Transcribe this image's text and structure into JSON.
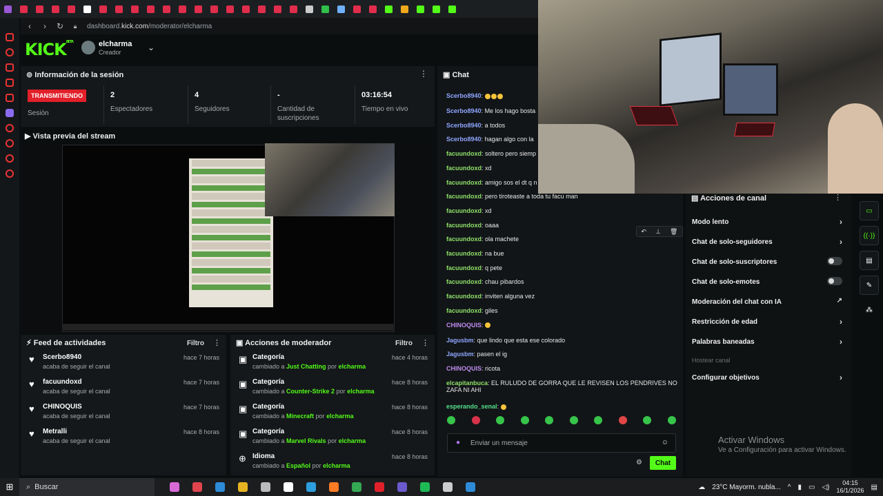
{
  "browser": {
    "url_prefix": "dashboard.",
    "url_host": "kick.com",
    "url_path": "/moderator/elcharma",
    "tabs": [
      "#9a58d6",
      "#e02d4c",
      "#e02d4c",
      "#e02d4c",
      "#e02d4c",
      "#ffffff",
      "#e02d4c",
      "#e02d4c",
      "#e02d4c",
      "#e02d4c",
      "#e02d4c",
      "#e02d4c",
      "#e02d4c",
      "#e02d4c",
      "#e02d4c",
      "#e02d4c",
      "#e02d4c",
      "#e02d4c",
      "#e02d4c",
      "#cccccc",
      "#2fbf4a",
      "#6fb1ff",
      "#e02d4c",
      "#e02d4c",
      "#53fc18",
      "#f0a81c",
      "#53fc18",
      "#53fc18",
      "#53fc18"
    ]
  },
  "header": {
    "logo": "KICK",
    "logo_beta": "BETA",
    "username": "elcharma",
    "role": "Creador"
  },
  "session": {
    "title": "Información de la sesión",
    "badge": "TRANSMITIENDO",
    "badge_label": "Sesión",
    "stats": [
      {
        "value": "2",
        "label": "Espectadores"
      },
      {
        "value": "4",
        "label": "Seguidores"
      },
      {
        "value": "-",
        "label": "Cantidad de suscripciones"
      },
      {
        "value": "03:16:54",
        "label": "Tiempo en vivo"
      }
    ]
  },
  "preview": {
    "title": "Vista previa del stream"
  },
  "feed": {
    "title": "Feed de actividades",
    "filter": "Filtro",
    "items": [
      {
        "name": "Scerbo8940",
        "sub": "acaba de seguir el canal",
        "time": "hace 7 horas"
      },
      {
        "name": "facuundoxd",
        "sub": "acaba de seguir el canal",
        "time": "hace 7 horas"
      },
      {
        "name": "CHINOQUIS",
        "sub": "acaba de seguir el canal",
        "time": "hace 7 horas"
      },
      {
        "name": "Metralli",
        "sub": "acaba de seguir el canal",
        "time": "hace 8 horas"
      }
    ]
  },
  "mod_actions": {
    "title": "Acciones de moderador",
    "filter": "Filtro",
    "items": [
      {
        "name": "Categoría",
        "pre": "cambiado a ",
        "what": "Just Chatting",
        "by": " por ",
        "who": "elcharma",
        "time": "hace 4 horas"
      },
      {
        "name": "Categoría",
        "pre": "cambiado a ",
        "what": "Counter-Strike 2",
        "by": " por ",
        "who": "elcharma",
        "time": "hace 8 horas"
      },
      {
        "name": "Categoría",
        "pre": "cambiado a ",
        "what": "Minecraft",
        "by": " por ",
        "who": "elcharma",
        "time": "hace 8 horas"
      },
      {
        "name": "Categoría",
        "pre": "cambiado a ",
        "what": "Marvel Rivals",
        "by": " por ",
        "who": "elcharma",
        "time": "hace 8 horas"
      },
      {
        "name": "Idioma",
        "pre": "cambiado a ",
        "what": "Español",
        "by": " por ",
        "who": "elcharma",
        "time": "hace 8 horas"
      }
    ]
  },
  "chat": {
    "title": "Chat",
    "messages": [
      {
        "user": "Scerbo8940",
        "color": "#8ea6ff",
        "text": "",
        "emotes": 3
      },
      {
        "user": "Scerbo8940",
        "color": "#8ea6ff",
        "text": "Me los hago bosta",
        "emotes": 0
      },
      {
        "user": "Scerbo8940",
        "color": "#8ea6ff",
        "text": "a todos",
        "emotes": 0
      },
      {
        "user": "Scerbo8940",
        "color": "#8ea6ff",
        "text": "hagan algo con la",
        "emotes": 0
      },
      {
        "user": "facuundoxd",
        "color": "#8ee06a",
        "text": "soltero pero siemp",
        "emotes": 0
      },
      {
        "user": "facuundoxd",
        "color": "#8ee06a",
        "text": "xd",
        "emotes": 0
      },
      {
        "user": "facuundoxd",
        "color": "#8ee06a",
        "text": "amigo sos el dt q n",
        "emotes": 0
      },
      {
        "user": "facuundoxd",
        "color": "#8ee06a",
        "text": "pero tiroteaste a toda tu facu man",
        "emotes": 0
      },
      {
        "user": "facuundoxd",
        "color": "#8ee06a",
        "text": "xd",
        "emotes": 0
      },
      {
        "user": "facuundoxd",
        "color": "#8ee06a",
        "text": "oaaa",
        "emotes": 0
      },
      {
        "user": "facuundoxd",
        "color": "#8ee06a",
        "text": "ola machete",
        "emotes": 0
      },
      {
        "user": "facuundoxd",
        "color": "#8ee06a",
        "text": "na bue",
        "emotes": 0
      },
      {
        "user": "facuundoxd",
        "color": "#8ee06a",
        "text": "q pete",
        "emotes": 0
      },
      {
        "user": "facuundoxd",
        "color": "#8ee06a",
        "text": "chau pibardos",
        "emotes": 0
      },
      {
        "user": "facuundoxd",
        "color": "#8ee06a",
        "text": "inviten alguna vez",
        "emotes": 0
      },
      {
        "user": "facuundoxd",
        "color": "#8ee06a",
        "text": "giles",
        "emotes": 0
      },
      {
        "user": "CHINOQUIS",
        "color": "#c08cf0",
        "text": "",
        "emotes": 1
      },
      {
        "user": "Jagusbm",
        "color": "#8ea6ff",
        "text": "que lindo que esta ese colorado",
        "emotes": 0
      },
      {
        "user": "Jagusbm",
        "color": "#8ea6ff",
        "text": "pasen el ig",
        "emotes": 0
      },
      {
        "user": "CHINOQUIS",
        "color": "#c08cf0",
        "text": "ricota",
        "emotes": 0
      },
      {
        "user": "elcapitanbuca",
        "color": "#8ee06a",
        "text": "EL RULUDO DE GORRA QUE LE REVISEN LOS PENDRIVES NO",
        "text2": "ZAFA NI AHI",
        "emotes": 0
      },
      {
        "user": "esperando_senal",
        "color": "#53e08a",
        "text": "",
        "emotes": 1
      }
    ],
    "input_placeholder": "Enviar un mensaje",
    "send_label": "Chat"
  },
  "channel_actions": {
    "title": "Acciones de canal",
    "items": [
      {
        "label": "Modo lento",
        "control": "chevron"
      },
      {
        "label": "Chat de solo-seguidores",
        "control": "chevron"
      },
      {
        "label": "Chat de solo-suscriptores",
        "control": "toggle"
      },
      {
        "label": "Chat de solo-emotes",
        "control": "toggle"
      },
      {
        "label": "Moderación del chat con IA",
        "control": "external"
      },
      {
        "label": "Restricción de edad",
        "control": "chevron"
      },
      {
        "label": "Palabras baneadas",
        "control": "chevron"
      },
      {
        "label": "Hostear canal",
        "control": "none",
        "disabled": true
      },
      {
        "label": "Configurar objetivos",
        "control": "chevron"
      }
    ],
    "watermark_title": "Activar Windows",
    "watermark_sub": "Ve a Configuración para activar Windows."
  },
  "taskbar": {
    "search": "Buscar",
    "weather": "23°C  Mayorm. nubla...",
    "time": "04:15",
    "date": "16/1/2026",
    "apps": [
      "#d86ad6",
      "#e0444f",
      "#2e8bd8",
      "#e6b422",
      "#bbbbbb",
      "#ffffff",
      "#2d9ee0",
      "#ff7b24",
      "#34a853",
      "#e0202a",
      "#6a5acd",
      "#1db954",
      "#cccccc",
      "#2e8bd8"
    ]
  }
}
